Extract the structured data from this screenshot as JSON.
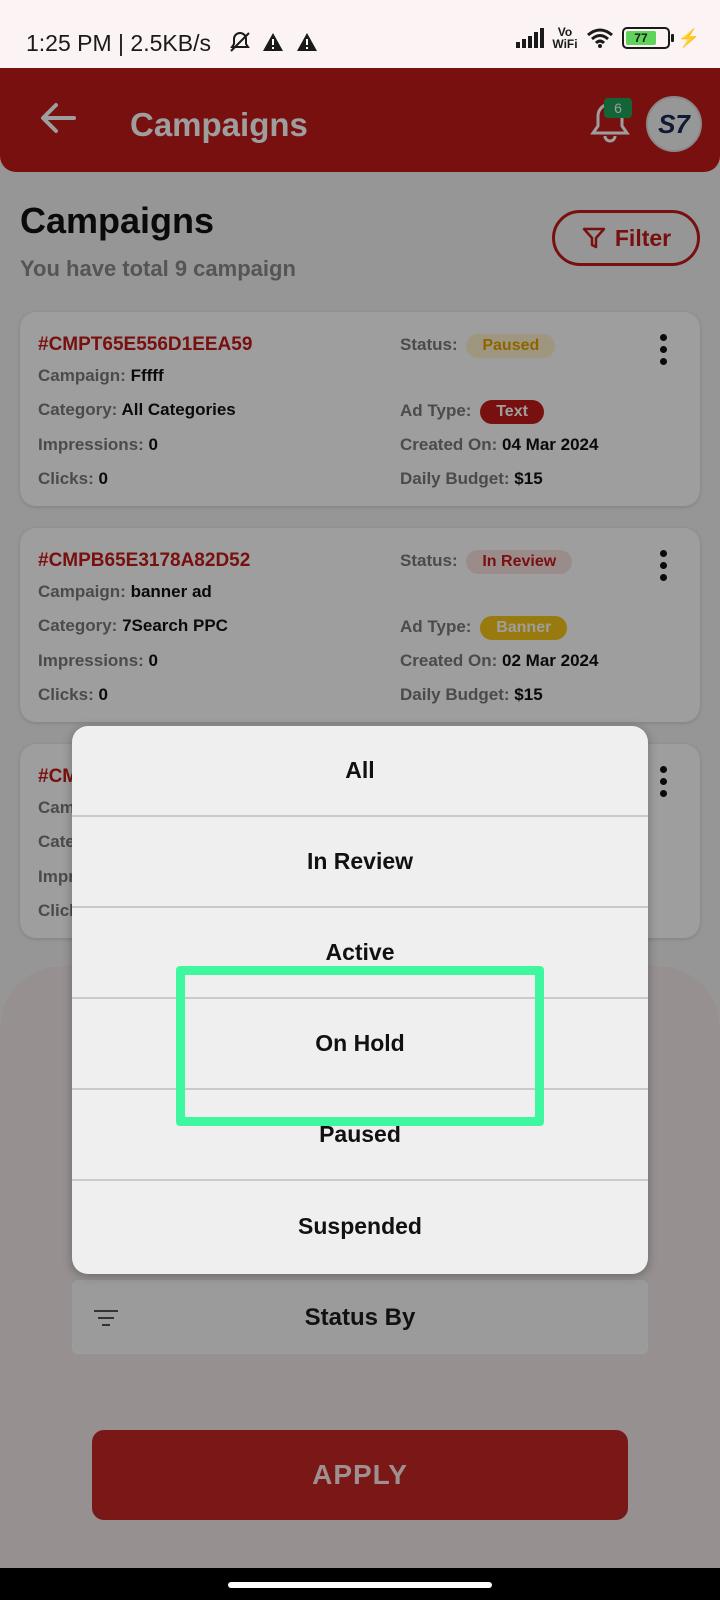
{
  "status_bar": {
    "time_info": "1:25 PM | 2.5KB/s",
    "network_label_top": "Vo",
    "network_label_bottom": "WiFi",
    "battery": "77"
  },
  "app_bar": {
    "title": "Campaigns",
    "notification_count": "6",
    "avatar_text": "S7"
  },
  "page": {
    "title": "Campaigns",
    "subtitle": "You have total 9 campaign",
    "filter_label": "Filter"
  },
  "colors": {
    "brand": "#c31a1a",
    "paused_pill_bg": "#fff3cd",
    "paused_pill_fg": "#e6a200",
    "review_pill_bg": "#fbe3e3",
    "review_pill_fg": "#c31a1a",
    "text_pill_bg": "#c31a1a",
    "banner_pill_bg": "#f5c518",
    "highlight": "#3ef79f"
  },
  "campaigns": [
    {
      "id": "#CMPT65E556D1EEA59",
      "campaign_label": "Campaign:",
      "campaign": "Fffff",
      "category_label": "Category:",
      "category": "All Categories",
      "impressions_label": "Impressions:",
      "impressions": "0",
      "clicks_label": "Clicks:",
      "clicks": "0",
      "status_label": "Status:",
      "status": "Paused",
      "ad_type_label": "Ad Type:",
      "ad_type": "Text",
      "created_label": "Created On:",
      "created": "04 Mar 2024",
      "budget_label": "Daily Budget:",
      "budget": "$15"
    },
    {
      "id": "#CMPB65E3178A82D52",
      "campaign_label": "Campaign:",
      "campaign": "banner ad",
      "category_label": "Category:",
      "category": "7Search PPC",
      "impressions_label": "Impressions:",
      "impressions": "0",
      "clicks_label": "Clicks:",
      "clicks": "0",
      "status_label": "Status:",
      "status": "In Review",
      "ad_type_label": "Ad Type:",
      "ad_type": "Banner",
      "created_label": "Created On:",
      "created": "02 Mar 2024",
      "budget_label": "Daily Budget:",
      "budget": "$15"
    },
    {
      "id": "#CM",
      "campaign_label": "Cam",
      "category_label": "Cate",
      "impressions_label": "Impr",
      "clicks_label": "Click"
    }
  ],
  "status_menu": {
    "options": [
      "All",
      "In Review",
      "Active",
      "On Hold",
      "Paused",
      "Suspended"
    ]
  },
  "sheet": {
    "status_by_label": "Status By",
    "apply_label": "APPLY"
  }
}
